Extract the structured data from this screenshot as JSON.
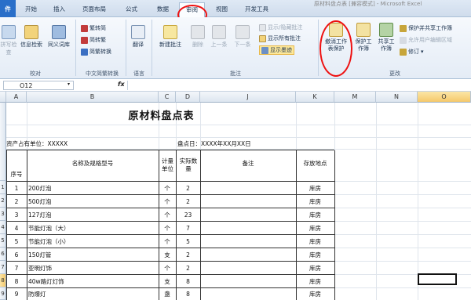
{
  "tabs": [
    "件",
    "开始",
    "插入",
    "页面布局",
    "公式",
    "数据",
    "审阅",
    "视图",
    "开发工具"
  ],
  "window_title": "原材料盘点表  [兼容模式] - Microsoft Excel",
  "ribbon": {
    "proofing": {
      "spell": "拼写检查",
      "research": "信息检索",
      "thesaurus": "同义词库",
      "label": "校对"
    },
    "chinese": {
      "to_trad": "繁转简",
      "to_simp": "简转繁",
      "convert": "简繁转换",
      "label": "中文简繁转换"
    },
    "language": {
      "translate": "翻译",
      "label": "语言"
    },
    "comments": {
      "new": "新建批注",
      "delete": "删除",
      "prev": "上一条",
      "next": "下一条",
      "show_hide": "显示/隐藏批注",
      "show_all": "显示所有批注",
      "show_ink": "显示墨迹",
      "label": "批注"
    },
    "changes": {
      "unprotect": "撤消工作表保护",
      "protect_wb": "保护工作簿",
      "share_wb": "共享工作簿",
      "protect_share": "保护并共享工作簿",
      "allow_edit": "允许用户编辑区域",
      "track": "修订",
      "label": "更改"
    }
  },
  "formula_bar": {
    "name_box": "O12",
    "fx": "fx",
    "value": ""
  },
  "columns": [
    "A",
    "B",
    "C",
    "D",
    "J",
    "K",
    "M",
    "N",
    "O"
  ],
  "row_numbers": [
    "1",
    "2",
    "3",
    "4",
    "5",
    "6",
    "7",
    "8",
    "9"
  ],
  "sheet": {
    "title": "原材料盘点表",
    "unit": "资产占有单位：XXXXX",
    "date": "盘点日：XXXX年XX月XX日",
    "headers": {
      "no": "序号",
      "name": "名称及规格型号",
      "unit": "计量单位",
      "qty": "实际数量",
      "remark": "备注",
      "loc": "存放地点"
    },
    "rows": [
      {
        "no": "1",
        "name": "200灯泡",
        "unit": "个",
        "qty": "2",
        "loc": "库房"
      },
      {
        "no": "2",
        "name": "500灯泡",
        "unit": "个",
        "qty": "2",
        "loc": "库房"
      },
      {
        "no": "3",
        "name": "127灯泡",
        "unit": "个",
        "qty": "23",
        "loc": "库房"
      },
      {
        "no": "4",
        "name": "节能灯泡（大）",
        "unit": "个",
        "qty": "7",
        "loc": "库房"
      },
      {
        "no": "5",
        "name": "节能灯泡（小）",
        "unit": "个",
        "qty": "5",
        "loc": "库房"
      },
      {
        "no": "6",
        "name": "150灯管",
        "unit": "支",
        "qty": "2",
        "loc": "库房"
      },
      {
        "no": "7",
        "name": "亚明灯饰",
        "unit": "个",
        "qty": "2",
        "loc": "库房"
      },
      {
        "no": "8",
        "name": "40w路灯灯饰",
        "unit": "支",
        "qty": "8",
        "loc": "库房"
      },
      {
        "no": "9",
        "name": "防爆灯",
        "unit": "盏",
        "qty": "8",
        "loc": "库房"
      }
    ]
  }
}
